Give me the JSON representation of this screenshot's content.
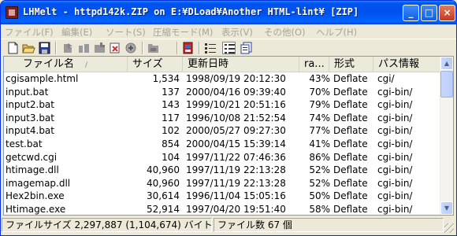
{
  "window": {
    "title": "LHMelt - httpd142k.ZIP on E:¥DLoad¥Another HTML-lint¥ [ZIP]"
  },
  "controls": {
    "minimize": "_",
    "maximize": "□",
    "close": "×"
  },
  "menu": [
    "ファイル(F)",
    "編集(E)",
    "ソート(S)",
    "圧縮モード(M)",
    "表示(V)",
    "その他(O)",
    "ヘルプ(H)"
  ],
  "toolbar_icons": [
    "new-archive-icon",
    "open-folder-icon",
    "save-icon",
    "extract-icon",
    "extract-all-icon",
    "add-files-icon",
    "delete-icon",
    "properties-icon",
    "compress-icon",
    "list-view-icon",
    "detail-view-icon",
    "large-icon-view-icon"
  ],
  "columns": [
    "ファイル名",
    "サイズ",
    "更新日時",
    "ra...",
    "形式",
    "パス情報"
  ],
  "sort_indicator": "/",
  "files": [
    {
      "name": "cgisample.html",
      "size": "1,534",
      "date": "1998/09/19 20:12:30",
      "ratio": "43%",
      "method": "Deflate",
      "path": "cgi/"
    },
    {
      "name": "input.bat",
      "size": "137",
      "date": "2000/04/16 09:39:40",
      "ratio": "70%",
      "method": "Deflate",
      "path": "cgi-bin/"
    },
    {
      "name": "input2.bat",
      "size": "143",
      "date": "1999/10/21 20:51:16",
      "ratio": "79%",
      "method": "Deflate",
      "path": "cgi-bin/"
    },
    {
      "name": "input3.bat",
      "size": "117",
      "date": "1996/10/08 21:52:54",
      "ratio": "74%",
      "method": "Deflate",
      "path": "cgi-bin/"
    },
    {
      "name": "input4.bat",
      "size": "102",
      "date": "2000/05/27 09:27:30",
      "ratio": "77%",
      "method": "Deflate",
      "path": "cgi-bin/"
    },
    {
      "name": "test.bat",
      "size": "854",
      "date": "2000/04/15 15:39:14",
      "ratio": "41%",
      "method": "Deflate",
      "path": "cgi-bin/"
    },
    {
      "name": "getcwd.cgi",
      "size": "104",
      "date": "1997/11/22 07:46:36",
      "ratio": "86%",
      "method": "Deflate",
      "path": "cgi-bin/"
    },
    {
      "name": "htimage.dll",
      "size": "40,960",
      "date": "1997/11/19 22:13:28",
      "ratio": "52%",
      "method": "Deflate",
      "path": "cgi-bin/"
    },
    {
      "name": "imagemap.dll",
      "size": "40,960",
      "date": "1997/11/19 22:13:28",
      "ratio": "52%",
      "method": "Deflate",
      "path": "cgi-bin/"
    },
    {
      "name": "Hex2bin.exe",
      "size": "30,614",
      "date": "1996/11/04 15:05:16",
      "ratio": "50%",
      "method": "Deflate",
      "path": "cgi-bin/"
    },
    {
      "name": "Htimage.exe",
      "size": "52,914",
      "date": "1997/04/20 19:51:40",
      "ratio": "58%",
      "method": "Deflate",
      "path": "cgi-bin/"
    }
  ],
  "status": {
    "size": "ファイルサイズ 2,297,887 (1,104,674) バイト",
    "count": "ファイル数  67 個"
  }
}
